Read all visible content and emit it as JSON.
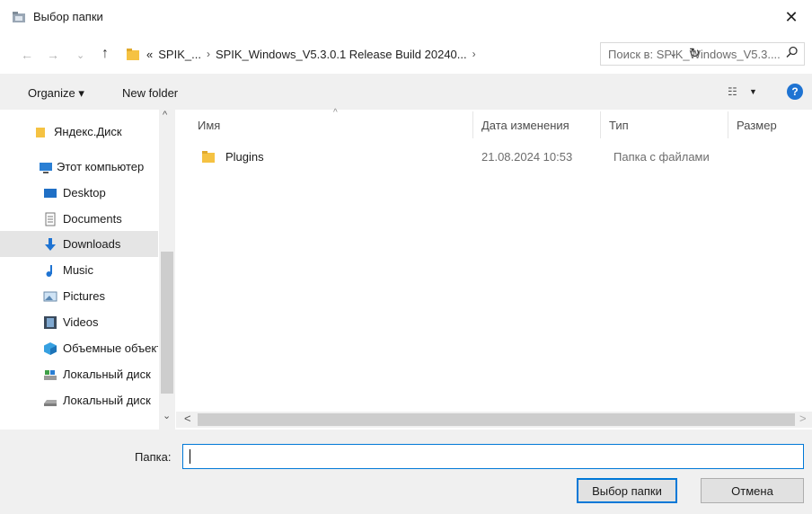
{
  "window": {
    "title": "Выбор папки",
    "close_glyph": "✕"
  },
  "navigation": {
    "back_glyph": "←",
    "forward_glyph": "→",
    "recent_glyph": "⌄",
    "up_glyph": "↑",
    "breadcrumb": [
      {
        "label": "«"
      },
      {
        "label": "SPIK_..."
      },
      {
        "label": "SPIK_Windows_V5.3.0.1 Release Build 20240..."
      }
    ],
    "crumb_sep": "›",
    "dropdown_glyph": "⌄",
    "refresh_glyph": "↻"
  },
  "search": {
    "placeholder": "Поиск в: SPIK_Windows_V5.3....",
    "icon": "search-icon"
  },
  "toolbar": {
    "organize_label": "Organize ▾",
    "new_folder_label": "New folder",
    "view_glyph": "☷",
    "view_dd_glyph": "▼",
    "help_glyph": "?"
  },
  "sidebar": {
    "items": [
      {
        "label": "Яндекс.Диск",
        "icon": "yandex-disk-icon"
      },
      {
        "label": "Этот компьютер",
        "icon": "this-pc-icon"
      },
      {
        "label": "Desktop",
        "icon": "desktop-icon"
      },
      {
        "label": "Documents",
        "icon": "documents-icon"
      },
      {
        "label": "Downloads",
        "icon": "downloads-icon",
        "selected": true
      },
      {
        "label": "Music",
        "icon": "music-icon"
      },
      {
        "label": "Pictures",
        "icon": "pictures-icon"
      },
      {
        "label": "Videos",
        "icon": "videos-icon"
      },
      {
        "label": "Объемные объекты",
        "icon": "3d-objects-icon"
      },
      {
        "label": "Локальный диск",
        "icon": "local-disk-icon"
      },
      {
        "label": "Локальный диск",
        "icon": "local-disk-2-icon"
      }
    ],
    "scroll_up_glyph": "^",
    "scroll_down_glyph": "⌄"
  },
  "file_list": {
    "columns": [
      "Имя",
      "Дата изменения",
      "Тип",
      "Размер"
    ],
    "sort_glyph": "^",
    "rows": [
      {
        "name": "Plugins",
        "modified": "21.08.2024 10:53",
        "type": "Папка с файлами",
        "size": ""
      }
    ],
    "scroll_left_glyph": "<",
    "scroll_right_glyph": ">"
  },
  "footer": {
    "folder_label": "Папка:",
    "folder_value": "",
    "select_button": "Выбор папки",
    "cancel_button": "Отмена"
  },
  "colors": {
    "accent": "#0078d7",
    "folder_yellow": "#f5c242",
    "help_blue": "#1e73d2"
  }
}
